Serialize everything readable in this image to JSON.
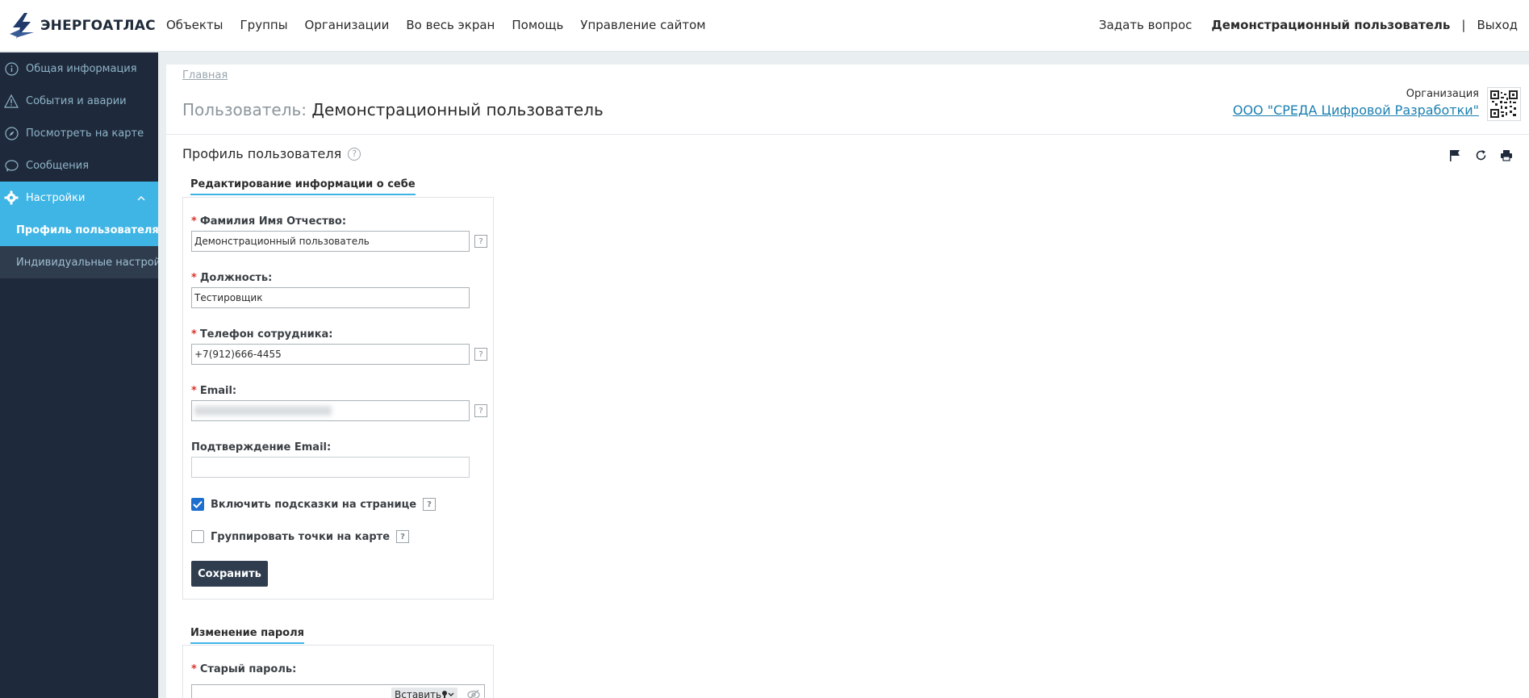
{
  "header": {
    "logo_text": "ЭНЕРГОАТЛАС",
    "nav": [
      "Объекты",
      "Группы",
      "Организации",
      "Во весь экран",
      "Помощь",
      "Управление сайтом"
    ],
    "ask_question": "Задать вопрос",
    "user_name": "Демонстрационный пользователь",
    "separator": "|",
    "logout": "Выход"
  },
  "sidebar": {
    "items": [
      {
        "label": "Общая информация",
        "icon": "info-icon"
      },
      {
        "label": "События и аварии",
        "icon": "warning-icon"
      },
      {
        "label": "Посмотреть на карте",
        "icon": "compass-icon"
      },
      {
        "label": "Сообщения",
        "icon": "chat-icon"
      },
      {
        "label": "Настройки",
        "icon": "gear-icon",
        "active": true
      }
    ],
    "subitems": [
      {
        "label": "Профиль пользователя",
        "current": true
      },
      {
        "label": "Индивидуальные настрой..."
      }
    ]
  },
  "content": {
    "breadcrumb": "Главная",
    "title_prefix": "Пользователь:",
    "title_name": "Демонстрационный пользователь",
    "org_label": "Организация",
    "org_name": "ООО \"СРЕДА Цифровой Разработки\"",
    "section_title": "Профиль пользователя",
    "help_glyph": "?",
    "profile_tab": "Редактирование информации о себе",
    "fields": {
      "fio_label": "Фамилия Имя Отчество:",
      "fio_value": "Демонстрационный пользователь",
      "position_label": "Должность:",
      "position_value": "Тестировщик",
      "phone_label": "Телефон сотрудника:",
      "phone_value": "+7(912)666-4455",
      "email_label": "Email:",
      "email_confirm_label": "Подтверждение Email:",
      "required_mark": "*"
    },
    "checkboxes": {
      "hints_label": "Включить подсказки на странице",
      "hints_checked": true,
      "group_label": "Группировать точки на карте",
      "group_checked": false
    },
    "save_button": "Сохранить",
    "password_tab": "Изменение пароля",
    "old_password_label": "Старый пароль:",
    "paste_label": "Вставить"
  },
  "colors": {
    "accent": "#3fb5e5",
    "sidebar_bg": "#1e2a3b",
    "button_bg": "#2f3d4f",
    "link": "#1a7fb0",
    "required": "#d9342b"
  }
}
